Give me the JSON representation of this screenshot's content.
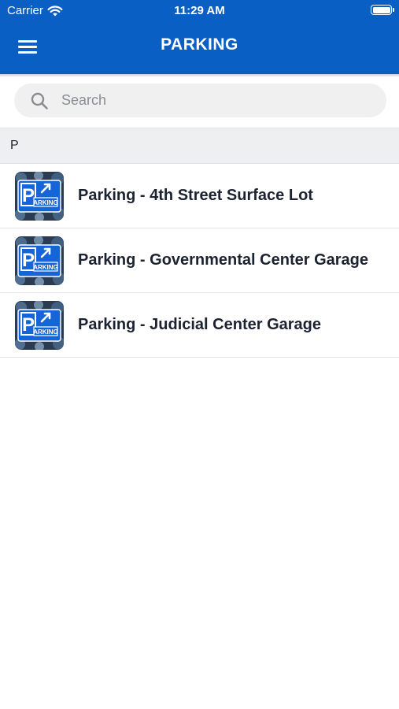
{
  "status_bar": {
    "carrier": "Carrier",
    "time": "11:29 AM"
  },
  "header": {
    "title": "PARKING",
    "background_color": "#0a5fc4",
    "menu_icon": "hamburger-menu-icon"
  },
  "search": {
    "placeholder": "Search",
    "value": "",
    "icon": "search-icon"
  },
  "section": {
    "letter": "P"
  },
  "items": [
    {
      "label": "Parking - 4th Street Surface Lot",
      "icon": "parking-sign-icon"
    },
    {
      "label": "Parking - Governmental Center Garage",
      "icon": "parking-sign-icon"
    },
    {
      "label": "Parking - Judicial Center Garage",
      "icon": "parking-sign-icon"
    }
  ]
}
